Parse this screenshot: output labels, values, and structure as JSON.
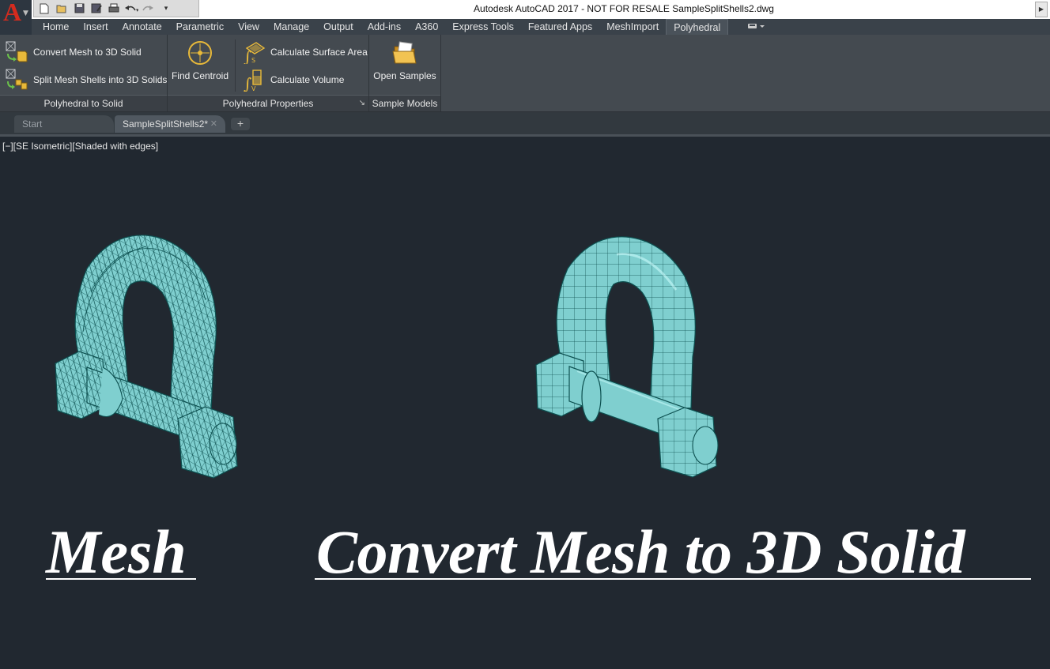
{
  "window": {
    "title": "Autodesk AutoCAD 2017 - NOT FOR RESALE    SampleSplitShells2.dwg",
    "app_letter": "A"
  },
  "quick_access": [
    "new-icon",
    "open-icon",
    "save-icon",
    "saveas-icon",
    "print-icon",
    "undo-icon",
    "redo-icon",
    "customize-icon"
  ],
  "ribbon_tabs": [
    "Home",
    "Insert",
    "Annotate",
    "Parametric",
    "View",
    "Manage",
    "Output",
    "Add-ins",
    "A360",
    "Express Tools",
    "Featured Apps",
    "MeshImport",
    "Polyhedral"
  ],
  "active_tab": "Polyhedral",
  "panels": {
    "to_solid": {
      "title": "Polyhedral to Solid",
      "convert_label": "Convert Mesh to 3D Solid",
      "split_label": "Split Mesh Shells into 3D Solids"
    },
    "properties": {
      "title": "Polyhedral Properties",
      "centroid_label": "Find Centroid",
      "area_label": "Calculate Surface Area",
      "volume_label": "Calculate Volume"
    },
    "samples": {
      "title": "Sample Models",
      "open_label": "Open Samples"
    }
  },
  "doc_tabs": {
    "start": "Start",
    "current": "SampleSplitShells2*",
    "plus": "+"
  },
  "viewport": {
    "controls": "[−][SE Isometric][Shaded with edges]",
    "label_left": "Mesh",
    "label_right": "Convert Mesh to 3D Solid"
  },
  "colors": {
    "model_fill": "#7fcfcf",
    "model_edge": "#0d5050",
    "background": "#212830",
    "logo_red": "#d52b1e"
  }
}
